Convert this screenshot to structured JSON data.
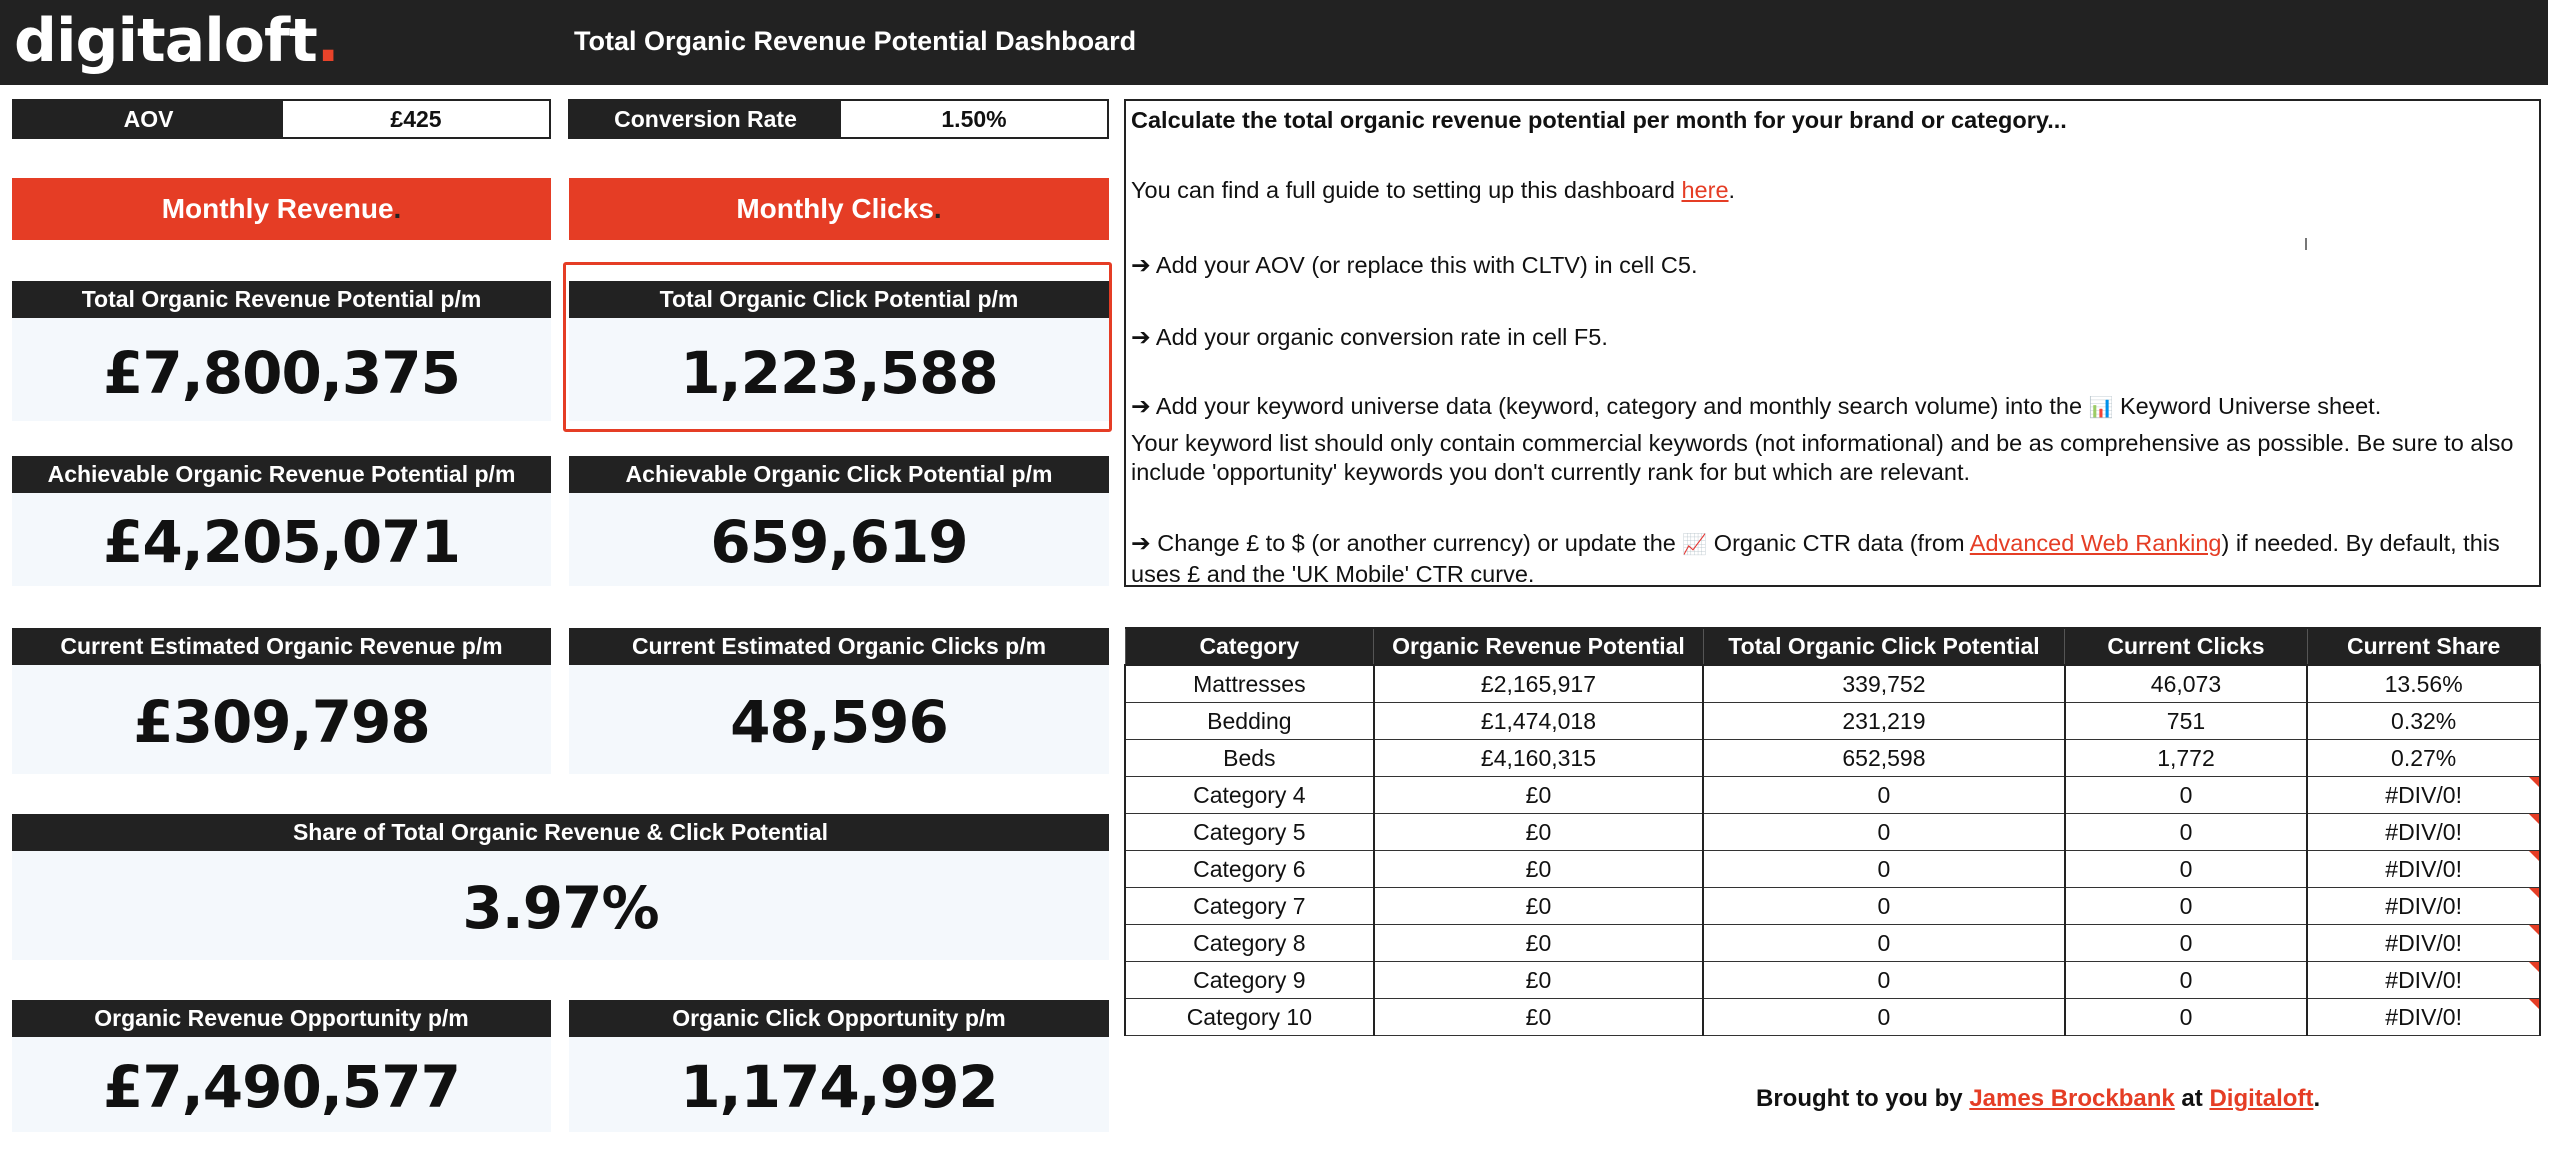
{
  "header": {
    "logo_text": "digitaloft",
    "logo_dot": ".",
    "title": "Total Organic Revenue Potential Dashboard"
  },
  "inputs": {
    "aov": {
      "label": "AOV",
      "value": "£425"
    },
    "conversion_rate": {
      "label": "Conversion Rate",
      "value": "1.50%"
    }
  },
  "buttons": {
    "monthly_revenue": {
      "label": "Monthly Revenue",
      "dot": "."
    },
    "monthly_clicks": {
      "label": "Monthly Clicks",
      "dot": "."
    }
  },
  "metrics": {
    "total_revenue": {
      "label": "Total Organic Revenue Potential p/m",
      "value": "£7,800,375"
    },
    "total_clicks": {
      "label": "Total Organic Click Potential p/m",
      "value": "1,223,588"
    },
    "achievable_revenue": {
      "label": "Achievable Organic Revenue Potential p/m",
      "value": "£4,205,071"
    },
    "achievable_clicks": {
      "label": "Achievable Organic Click Potential p/m",
      "value": "659,619"
    },
    "current_revenue": {
      "label": "Current Estimated Organic Revenue p/m",
      "value": "£309,798"
    },
    "current_clicks": {
      "label": "Current Estimated Organic Clicks p/m",
      "value": "48,596"
    },
    "share": {
      "label": "Share of Total Organic Revenue & Click Potential",
      "value": "3.97%"
    },
    "revenue_opportunity": {
      "label": "Organic Revenue Opportunity p/m",
      "value": "£7,490,577"
    },
    "click_opportunity": {
      "label": "Organic Click Opportunity p/m",
      "value": "1,174,992"
    }
  },
  "info": {
    "heading": "Calculate the total organic revenue potential per month for your brand or category...",
    "guide_pre": "You can find a full guide to setting up this dashboard ",
    "guide_link": "here",
    "guide_post": ".",
    "step1": "➔ Add your AOV (or replace this with CLTV) in cell C5.",
    "step2": "➔ Add your organic conversion rate in cell F5.",
    "step3_pre": "➔ Add your keyword universe data (keyword, category and monthly search volume) into the ",
    "step3_emoji": "📊",
    "step3_post": " Keyword Universe sheet.",
    "step3_note": "Your keyword list should only contain commercial keywords (not informational) and be as comprehensive as possible. Be sure to also include 'opportunity' keywords you don't currently rank for but which are relevant.",
    "step4_pre": "➔ Change £ to $ (or another currency) or update the ",
    "step4_emoji": "📈",
    "step4_mid": " Organic CTR data (from ",
    "step4_link": "Advanced Web Ranking",
    "step4_post": ") if needed. By default, this uses £ and the 'UK Mobile' CTR curve."
  },
  "table": {
    "headers": [
      "Category",
      "Organic Revenue Potential",
      "Total Organic Click Potential",
      "Current Clicks",
      "Current Share"
    ],
    "rows": [
      [
        "Mattresses",
        "£2,165,917",
        "339,752",
        "46,073",
        "13.56%"
      ],
      [
        "Bedding",
        "£1,474,018",
        "231,219",
        "751",
        "0.32%"
      ],
      [
        "Beds",
        "£4,160,315",
        "652,598",
        "1,772",
        "0.27%"
      ],
      [
        "Category 4",
        "£0",
        "0",
        "0",
        "#DIV/0!"
      ],
      [
        "Category 5",
        "£0",
        "0",
        "0",
        "#DIV/0!"
      ],
      [
        "Category 6",
        "£0",
        "0",
        "0",
        "#DIV/0!"
      ],
      [
        "Category 7",
        "£0",
        "0",
        "0",
        "#DIV/0!"
      ],
      [
        "Category 8",
        "£0",
        "0",
        "0",
        "#DIV/0!"
      ],
      [
        "Category 9",
        "£0",
        "0",
        "0",
        "#DIV/0!"
      ],
      [
        "Category 10",
        "£0",
        "0",
        "0",
        "#DIV/0!"
      ]
    ]
  },
  "footer": {
    "pre": "Brought to you by ",
    "author": "James Brockbank",
    "mid": " at ",
    "company": "Digitaloft",
    "post": "."
  },
  "colors": {
    "accent": "#e53d25",
    "dark": "#222222",
    "card_bg": "#f4f8fc"
  }
}
